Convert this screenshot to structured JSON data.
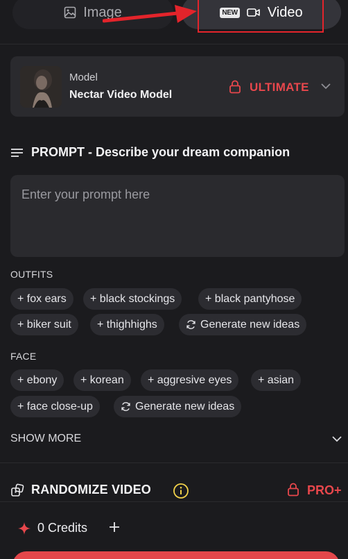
{
  "tabs": {
    "image_label": "Image",
    "video_label": "Video",
    "new_badge": "NEW"
  },
  "model": {
    "heading": "Model",
    "name": "Nectar Video Model",
    "tier": "ULTIMATE"
  },
  "prompt": {
    "title": "PROMPT - Describe your dream companion",
    "placeholder": "Enter your prompt here"
  },
  "outfits": {
    "label": "OUTFITS",
    "chips": [
      "+ fox ears",
      "+ black stockings",
      "+ black pantyhose",
      "+ biker suit",
      "+ thighhighs"
    ],
    "generate": "Generate new ideas"
  },
  "face": {
    "label": "FACE",
    "chips": [
      "+ ebony",
      "+ korean",
      "+ aggresive eyes",
      "+ asian",
      "+ face close-up"
    ],
    "generate": "Generate new ideas"
  },
  "show_more": "SHOW MORE",
  "randomize": {
    "title": "RANDOMIZE VIDEO",
    "tier": "PRO+"
  },
  "credits": {
    "label": "0 Credits"
  },
  "colors": {
    "background": "#1b1b1e",
    "card": "#2a2a2e",
    "accent_red": "#e8474c",
    "annotation_red": "#e3242b"
  }
}
